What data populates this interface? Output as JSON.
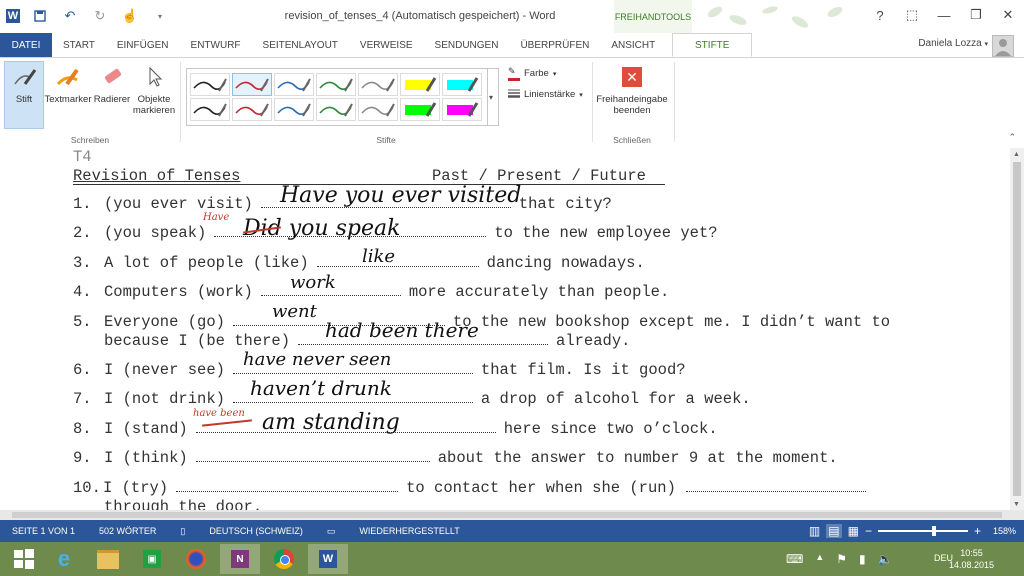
{
  "titlebar": {
    "title": "revision_of_tenses_4 (Automatisch gespeichert) - Word",
    "contextual_tab_group": "FREIHANDTOOLS",
    "help": "?",
    "minimize": "—",
    "restore": "❐",
    "close": "✕"
  },
  "tabs": [
    "DATEI",
    "START",
    "EINFÜGEN",
    "ENTWURF",
    "SEITENLAYOUT",
    "VERWEISE",
    "SENDUNGEN",
    "ÜBERPRÜFEN",
    "ANSICHT",
    "STIFTE"
  ],
  "user": "Daniela Lozza",
  "ribbon": {
    "schreiben": {
      "label": "Schreiben",
      "stift": "Stift",
      "textmarker": "Textmarker",
      "radierer": "Radierer",
      "objekte": "Objekte markieren"
    },
    "stifte": {
      "label": "Stifte",
      "farbe": "Farbe",
      "linienstaerke": "Linienstärke",
      "pen_colors": [
        "#222222",
        "#c8242b",
        "#2c6bb5",
        "#2a8a3a",
        "#8a8a8a",
        "#ffff00",
        "#00ffff",
        "#222222",
        "#c8242b",
        "#2c6bb5",
        "#2a8a3a",
        "#8a8a8a",
        "#00ff00",
        "#ff00ff"
      ]
    },
    "schliessen": {
      "label": "Schließen",
      "end": "Freihandeingabe beenden"
    }
  },
  "document": {
    "header": "T4",
    "title": "Revision of Tenses",
    "title_right": "Past / Present / Future",
    "items": [
      {
        "num": "1.",
        "pre": "(you ever visit)",
        "post": "that city?",
        "hw": "Have you ever visited"
      },
      {
        "num": "2.",
        "pre": "(you speak)",
        "post": "to the new employee yet?",
        "hw": "Did you speak",
        "hw_red": "Have"
      },
      {
        "num": "3.",
        "pre": "A lot of people (like)",
        "post": "dancing nowadays.",
        "hw": "like"
      },
      {
        "num": "4.",
        "pre": "Computers (work)",
        "post": "more accurately than people.",
        "hw": "work"
      },
      {
        "num": "5.",
        "pre": "Everyone (go)",
        "post": "to the new bookshop except me. I didn’t want to",
        "hw": "went",
        "line2_pre": "because I (be there)",
        "line2_post": "already.",
        "hw2": "had been there"
      },
      {
        "num": "6.",
        "pre": "I (never see)",
        "post": "that film. Is it good?",
        "hw": "have never seen"
      },
      {
        "num": "7.",
        "pre": "I (not drink)",
        "post": "a drop of alcohol for a week.",
        "hw": "haven’t drunk"
      },
      {
        "num": "8.",
        "pre": "I (stand)",
        "post": "here since two o’clock.",
        "hw": "am standing",
        "hw_red": "have been"
      },
      {
        "num": "9.",
        "pre": "I (think)",
        "post": "about the answer to number 9 at the moment.",
        "hw": ""
      },
      {
        "num": "10.",
        "pre": "I (try)",
        "post": "to contact her when she (run)",
        "hw": "",
        "line2_pre": "through the door."
      }
    ]
  },
  "status": {
    "page": "SEITE 1 VON 1",
    "words": "502 WÖRTER",
    "lang": "DEUTSCH (SCHWEIZ)",
    "state": "WIEDERHERGESTELLT",
    "zoom": "158%",
    "zoom_fraction": 0.62
  },
  "taskbar": {
    "time": "10:55",
    "date": "14.08.2015",
    "lang": "DEU"
  },
  "colors": {
    "accent": "#2b579a",
    "pen_tab": "#3c7c27",
    "ink": "#111111",
    "red_ink": "#c0392b"
  }
}
